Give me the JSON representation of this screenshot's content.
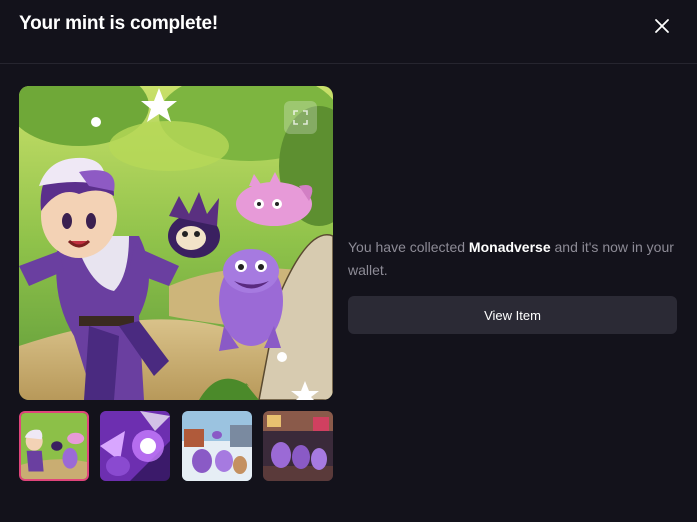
{
  "modal": {
    "title": "Your mint is complete!",
    "close_icon": "close-icon"
  },
  "gallery": {
    "expand_icon": "expand-icon",
    "selected_index": 0,
    "thumbnails": [
      {
        "alt": "trainer and monsters running"
      },
      {
        "alt": "purple monster energy blast"
      },
      {
        "alt": "monsters in snowy town"
      },
      {
        "alt": "monsters in arcade room"
      }
    ]
  },
  "info": {
    "prefix": "You have collected ",
    "collection": "Monadverse",
    "suffix": " and it's now in your wallet."
  },
  "actions": {
    "view_item_label": "View Item"
  },
  "colors": {
    "background": "#13121b",
    "button": "#2b2a35",
    "selected_border": "#e0457b",
    "muted_text": "#8d8b96"
  }
}
